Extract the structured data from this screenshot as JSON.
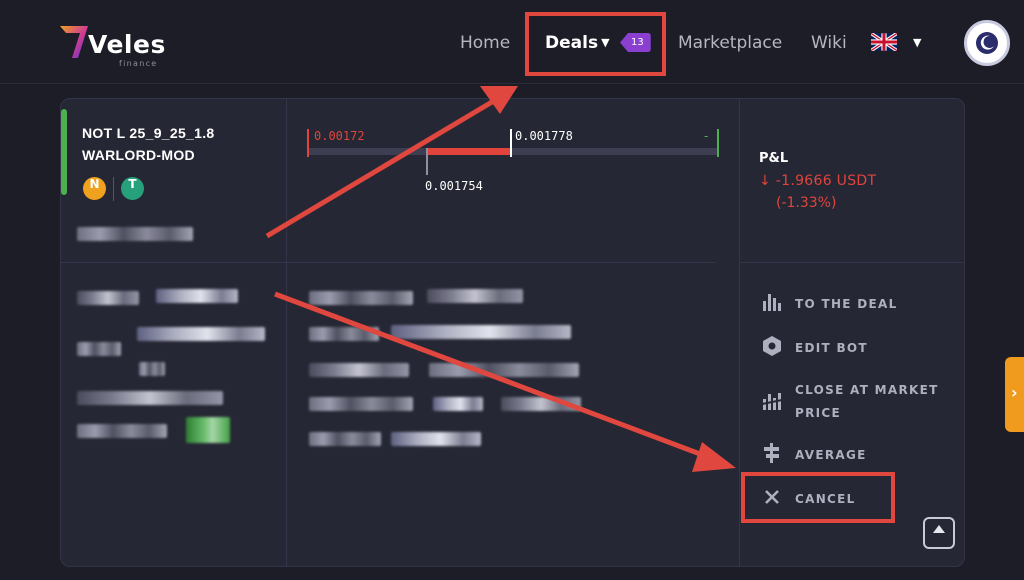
{
  "header": {
    "logo_word": "Veles",
    "logo_sub": "finance",
    "nav": {
      "home": "Home",
      "deals": "Deals",
      "deals_badge": "13",
      "marketplace": "Marketplace",
      "wiki": "Wiki"
    }
  },
  "deal": {
    "name_line1": "NOT L 25_9_25_1.8",
    "name_line2": "WARLORD-MOD",
    "coins": {
      "base_symbol": "N",
      "quote_symbol": "T"
    },
    "range": {
      "low_label": "0.00172",
      "current_label": "0.001778",
      "average_label": "0.001754",
      "high_label": "-"
    },
    "pnl": {
      "title": "P&L",
      "value": "↓ -1.9666 USDT",
      "percent": "(-1.33%)"
    }
  },
  "actions": {
    "to_deal": "TO THE DEAL",
    "edit_bot": "EDIT BOT",
    "close_market_1": "CLOSE AT MARKET",
    "close_market_2": "PRICE",
    "average": "AVERAGE",
    "cancel": "CANCEL"
  },
  "colors": {
    "background": "#1c1d26",
    "card": "#262734",
    "loss": "#e0443c",
    "profit": "#4caf50",
    "accent_badge": "#8a3fd1",
    "side_tab": "#f09a1e",
    "annotation": "#e0473f"
  },
  "icons": [
    "logo-icon",
    "caret-down-icon",
    "uk-flag-icon",
    "moon-icon",
    "chart-bars-icon",
    "hexagon-icon",
    "close-market-icon",
    "average-icon",
    "close-icon",
    "chevron-up-icon",
    "chevron-right-icon"
  ]
}
